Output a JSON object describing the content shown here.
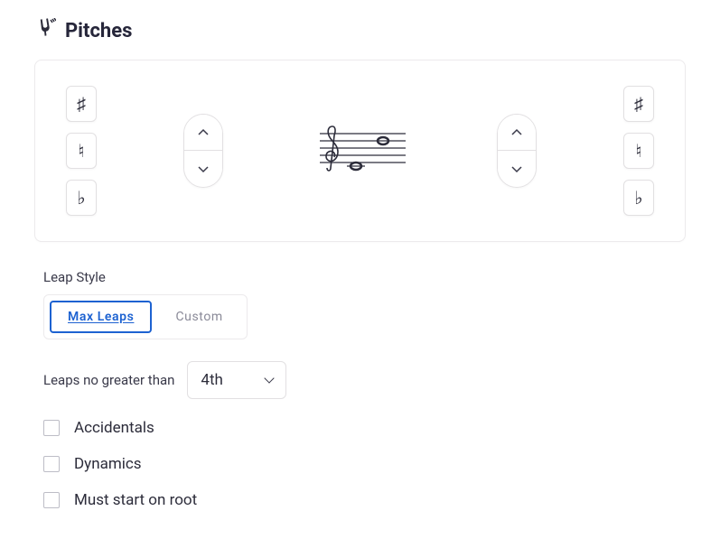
{
  "section": {
    "title": "Pitches",
    "icon": "tuning-fork-icon"
  },
  "panel": {
    "left_accidentals": {
      "sharp": "♯",
      "natural": "♮",
      "flat": "♭"
    },
    "right_accidentals": {
      "sharp": "♯",
      "natural": "♮",
      "flat": "♭"
    }
  },
  "leap_style": {
    "label": "Leap Style",
    "options": {
      "max_leaps": "Max Leaps",
      "custom": "Custom"
    },
    "selected": "max_leaps"
  },
  "leaps_no_greater": {
    "label": "Leaps no greater than",
    "value": "4th"
  },
  "checkboxes": {
    "accidentals": {
      "label": "Accidentals",
      "checked": false
    },
    "dynamics": {
      "label": "Dynamics",
      "checked": false
    },
    "must_start_on_root": {
      "label": "Must start on root",
      "checked": false
    }
  }
}
